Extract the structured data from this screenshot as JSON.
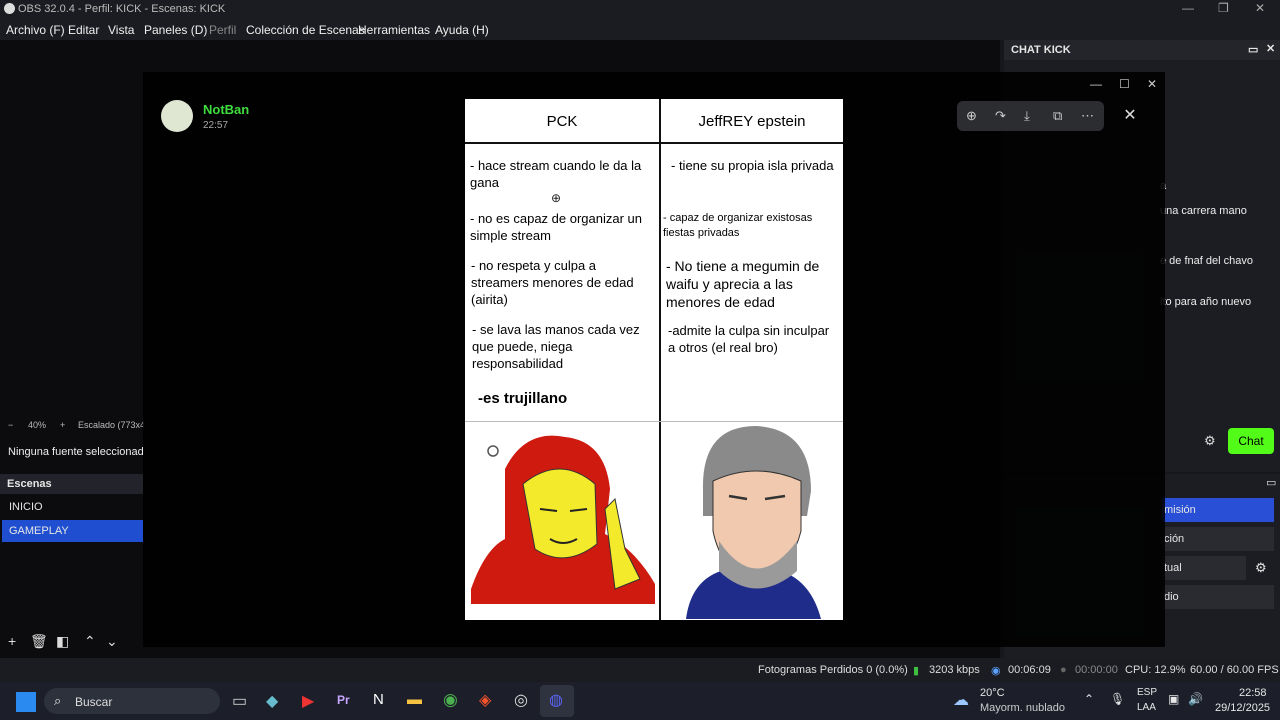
{
  "window": {
    "title": "OBS 32.0.4 - Perfil: KICK - Escenas: KICK"
  },
  "menu": [
    "Archivo (F)",
    "Editar",
    "Vista",
    "Paneles (D)",
    "Perfil",
    "Colección de Escenas",
    "Herramientas",
    "Ayuda (H)"
  ],
  "preview": {
    "zoom": "40%",
    "scale_label": "Escalado (773x4",
    "no_source": "Ninguna fuente seleccionad"
  },
  "scenes": {
    "header": "Escenas",
    "items": [
      "INICIO",
      "GAMEPLAY"
    ],
    "selected": "GAMEPLAY"
  },
  "chat": {
    "title": "CHAT KICK",
    "lines": [
      "a",
      "una carrera mano",
      "e de fnaf del chavo",
      "ito para año nuevo"
    ],
    "chat_button": "Chat"
  },
  "controls": {
    "buttons": [
      "misión",
      "ción",
      "tual",
      "dio"
    ]
  },
  "viewer": {
    "author": "NotBan",
    "time": "22:57",
    "close_symbol": "✕"
  },
  "meme": {
    "left_header": "PCK",
    "right_header": "JeffREY epstein",
    "left_items": [
      "- hace stream cuando le da la gana",
      "- no es capaz de organizar un simple stream",
      "- no respeta y culpa a streamers menores de edad (airita)",
      "- se lava las manos cada vez que puede, niega responsabilidad",
      "-es trujillano"
    ],
    "right_items": [
      "- tiene su propia isla privada",
      "- capaz de organizar existosas fiestas privadas",
      "- No tiene a megumin de waifu y aprecia a las menores de edad",
      "-admite la culpa sin inculpar a otros (el real bro)"
    ]
  },
  "status": {
    "dropped": "Fotogramas Perdidos 0 (0.0%)",
    "kbps": "3203 kbps",
    "rec_time": "00:06:09",
    "stream_time": "00:00:00",
    "cpu": "CPU: 12.9%",
    "fps": "60.00 / 60.00 FPS"
  },
  "taskbar": {
    "search": "Buscar",
    "weather_temp": "20°C",
    "weather_desc": "Mayorm. nublado",
    "lang1": "ESP",
    "lang2": "LAA",
    "clock_time": "22:58",
    "clock_date": "29/12/2025"
  },
  "colors": {
    "kick_green": "#53fc18",
    "obs_selected": "#1f4fd0",
    "discord_blue": "#5865f2"
  }
}
